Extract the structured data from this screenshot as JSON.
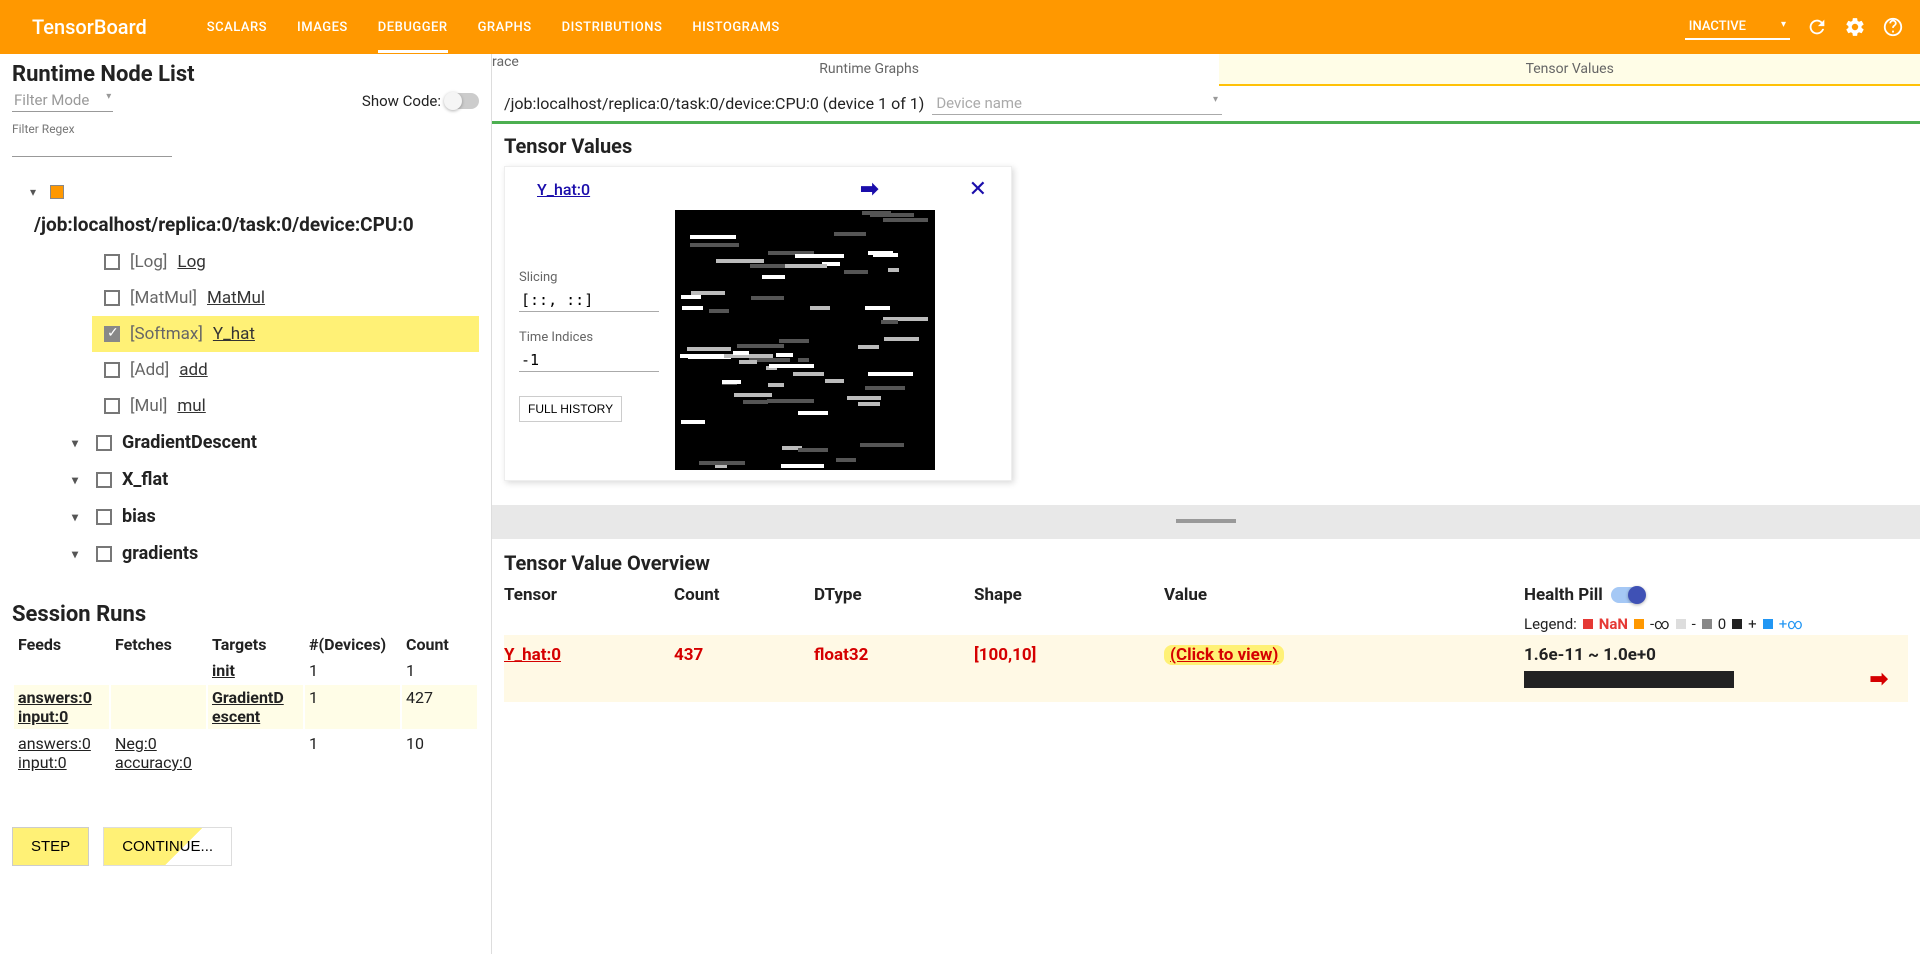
{
  "header": {
    "logo": "TensorBoard",
    "tabs": [
      "SCALARS",
      "IMAGES",
      "DEBUGGER",
      "GRAPHS",
      "DISTRIBUTIONS",
      "HISTOGRAMS"
    ],
    "active_tab": 2,
    "status": "INACTIVE"
  },
  "left": {
    "title": "Runtime Node List",
    "filter_mode": "Filter Mode",
    "show_code": "Show Code:",
    "filter_regex_label": "Filter Regex",
    "device_path": "/job:localhost/replica:0/task:0/device:CPU:0",
    "nodes": [
      {
        "type": "[Log]",
        "name": "Log",
        "checked": false
      },
      {
        "type": "[MatMul]",
        "name": "MatMul",
        "checked": false
      },
      {
        "type": "[Softmax]",
        "name": "Y_hat",
        "checked": true,
        "highlight": true
      },
      {
        "type": "[Add]",
        "name": "add",
        "checked": false
      },
      {
        "type": "[Mul]",
        "name": "mul",
        "checked": false
      }
    ],
    "groups": [
      "GradientDescent",
      "X_flat",
      "bias",
      "gradients"
    ],
    "session_title": "Session Runs",
    "sess_headers": [
      "Feeds",
      "Fetches",
      "Targets",
      "#(Devices)",
      "Count"
    ],
    "sess_rows": [
      {
        "feeds": "",
        "fetches": "",
        "targets": "init",
        "devices": "1",
        "count": "1",
        "hl": false
      },
      {
        "feeds": "answers:0\ninput:0",
        "fetches": "",
        "targets": "GradientDescent",
        "devices": "1",
        "count": "427",
        "hl": true
      },
      {
        "feeds": "answers:0\ninput:0",
        "fetches": "Neg:0\naccuracy:0",
        "targets": "",
        "devices": "1",
        "count": "10",
        "hl": false
      }
    ],
    "step_btn": "STEP",
    "continue_btn": "CONTINUE..."
  },
  "right": {
    "tabs": [
      "Runtime Graphs",
      "Tensor Values"
    ],
    "device_text": "/job:localhost/replica:0/task:0/device:CPU:0 (device 1 of 1)",
    "device_placeholder": "Device name",
    "tv_title": "Tensor Values",
    "card": {
      "link": "Y_hat:0",
      "slicing_label": "Slicing",
      "slicing_value": "[::, ::]",
      "time_label": "Time Indices",
      "time_value": "-1",
      "full_history": "FULL HISTORY"
    },
    "overview": {
      "title": "Tensor Value Overview",
      "headers": [
        "Tensor",
        "Count",
        "DType",
        "Shape",
        "Value",
        "Health Pill"
      ],
      "legend_label": "Legend:",
      "legend_items": [
        "NaN",
        "-∞",
        "-",
        "0",
        "+",
        "+∞"
      ],
      "row": {
        "tensor": "Y_hat:0",
        "count": "437",
        "dtype": "float32",
        "shape": "[100,10]",
        "value": "(Click to view)",
        "range": "1.6e-11 ~ 1.0e+0"
      }
    }
  }
}
